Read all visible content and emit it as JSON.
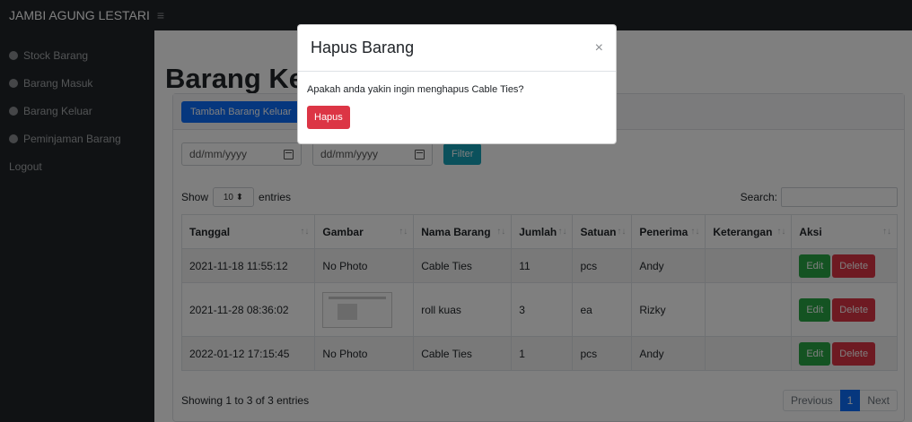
{
  "app": {
    "brand": "JAMBI AGUNG LESTARI",
    "menu_icon": "hamburger-icon"
  },
  "sidebar": {
    "items": [
      {
        "label": "Stock Barang",
        "icon": "dashboard-icon"
      },
      {
        "label": "Barang Masuk",
        "icon": "dashboard-icon"
      },
      {
        "label": "Barang Keluar",
        "icon": "dashboard-icon"
      },
      {
        "label": "Peminjaman Barang",
        "icon": "dashboard-icon"
      }
    ],
    "logout": "Logout"
  },
  "page": {
    "title": "Barang Keluar",
    "add_button": "Tambah Barang Keluar",
    "date_from_placeholder": "dd/mm/yyyy",
    "date_to_placeholder": "dd/mm/yyyy",
    "filter_button": "Filter",
    "show_label": "Show",
    "entries_value": "10",
    "entries_label": "entries",
    "search_label": "Search:"
  },
  "table": {
    "headers": [
      "Tanggal",
      "Gambar",
      "Nama Barang",
      "Jumlah",
      "Satuan",
      "Penerima",
      "Keterangan",
      "Aksi"
    ],
    "rows": [
      {
        "tanggal": "2021-11-18 11:55:12",
        "gambar": "No Photo",
        "nama": "Cable Ties",
        "jumlah": "11",
        "satuan": "pcs",
        "penerima": "Andy",
        "keterangan": ""
      },
      {
        "tanggal": "2021-11-28 08:36:02",
        "gambar": "",
        "nama": "roll kuas",
        "jumlah": "3",
        "satuan": "ea",
        "penerima": "Rizky",
        "keterangan": ""
      },
      {
        "tanggal": "2022-01-12 17:15:45",
        "gambar": "No Photo",
        "nama": "Cable Ties",
        "jumlah": "1",
        "satuan": "pcs",
        "penerima": "Andy",
        "keterangan": ""
      }
    ],
    "edit_label": "Edit",
    "delete_label": "Delete"
  },
  "footer": {
    "info": "Showing 1 to 3 of 3 entries",
    "previous": "Previous",
    "page": "1",
    "next": "Next"
  },
  "modal": {
    "title": "Hapus Barang",
    "close": "×",
    "message": "Apakah anda yakin ingin menghapus Cable Ties?",
    "confirm": "Hapus"
  },
  "colors": {
    "primary": "#0d6efd",
    "success": "#28a745",
    "danger": "#dc3545",
    "info": "#17a2b8",
    "dark": "#212529"
  }
}
